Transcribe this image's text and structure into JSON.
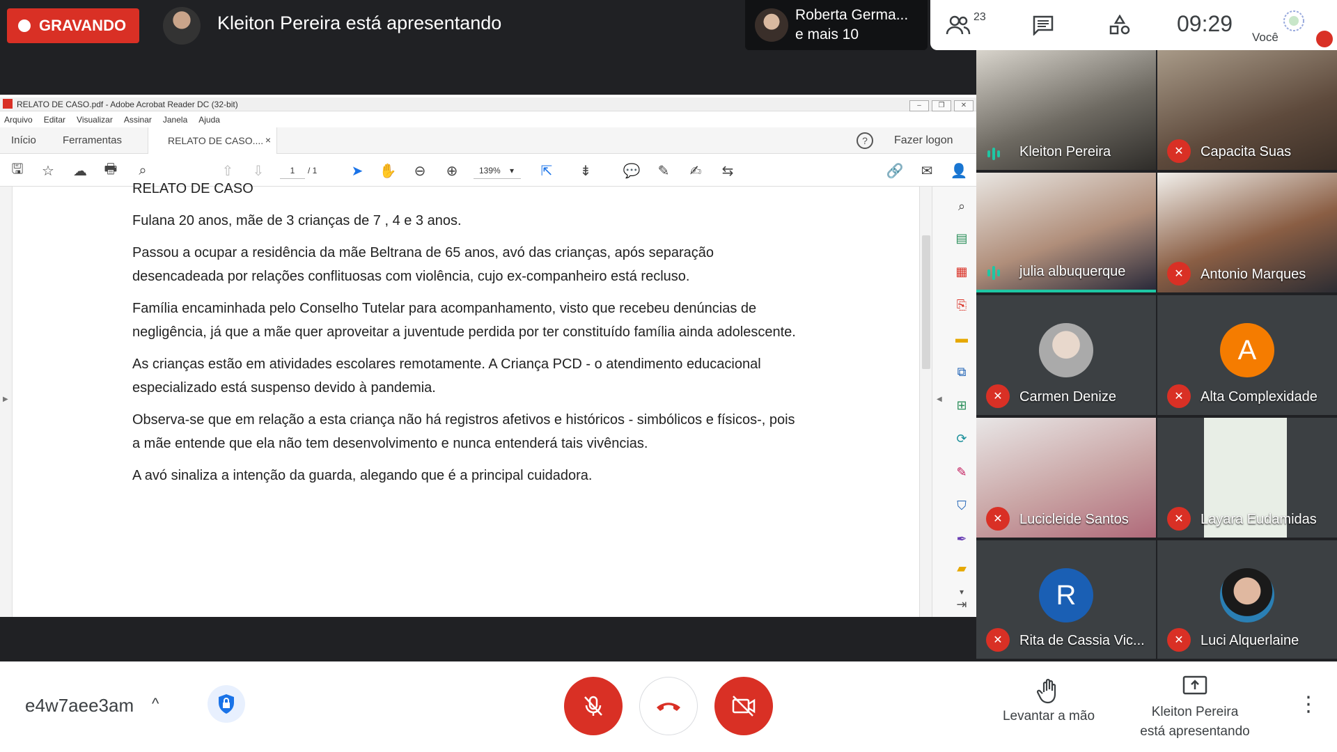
{
  "top": {
    "recording_label": "GRAVANDO",
    "presenting_title": "Kleiton Pereira está apresentando",
    "roberta_line1": "Roberta Germa...",
    "roberta_line2": "e mais 10",
    "people_count": "23",
    "clock": "09:29",
    "you_label": "Você"
  },
  "acrobat": {
    "window_title": "RELATO DE CASO.pdf - Adobe Acrobat Reader DC (32-bit)",
    "menu": [
      "Arquivo",
      "Editar",
      "Visualizar",
      "Assinar",
      "Janela",
      "Ajuda"
    ],
    "tab_home": "Início",
    "tab_tools": "Ferramentas",
    "tab_doc": "RELATO DE CASO....",
    "tab_close": "×",
    "help": "?",
    "logon": "Fazer logon",
    "page_current": "1",
    "page_total": "/ 1",
    "zoom": "139%",
    "doc_title": "RELATO DE CASO",
    "paragraphs": [
      "Fulana 20 anos, mãe de 3 crianças de 7 , 4 e 3 anos.",
      "Passou a ocupar a residência da mãe Beltrana de 65 anos, avó das crianças, após separação desencadeada por relações conflituosas com violência, cujo ex-companheiro está recluso.",
      "Família encaminhada pelo Conselho Tutelar para acompanhamento, visto que recebeu denúncias de negligência, já que a mãe quer aproveitar a juventude perdida por ter constituído família ainda adolescente.",
      "As crianças estão em atividades escolares remotamente. A Criança PCD - o atendimento educacional especializado está suspenso devido à pandemia.",
      "Observa-se que em relação a esta criança não há registros afetivos e históricos - simbólicos e físicos-, pois a mãe entende que ela não tem desenvolvimento e nunca entenderá tais vivências.",
      "A avó sinaliza a intenção da guarda, alegando que é a principal cuidadora."
    ]
  },
  "participants": [
    {
      "name": "Kleiton Pereira",
      "state": "speaking"
    },
    {
      "name": "Capacita Suas",
      "state": "muted"
    },
    {
      "name": "julia albuquerque",
      "state": "speaking"
    },
    {
      "name": "Antonio Marques",
      "state": "muted"
    },
    {
      "name": "Carmen Denize",
      "state": "muted"
    },
    {
      "name": "Alta Complexidade",
      "state": "muted",
      "initial": "A"
    },
    {
      "name": "Lucicleide Santos",
      "state": "muted"
    },
    {
      "name": "Layara Eudamidas",
      "state": "muted"
    },
    {
      "name": "Rita de Cassia Vic...",
      "state": "muted",
      "initial": "R"
    },
    {
      "name": "Luci Alquerlaine",
      "state": "muted"
    }
  ],
  "bottom": {
    "meeting_code": "e4w7aee3am",
    "caret": "^",
    "raise_hand": "Levantar a mão",
    "presenting_line1": "Kleiton Pereira",
    "presenting_line2": "está apresentando",
    "more": "⋮"
  },
  "colors": {
    "red": "#d93025",
    "dark": "#202124",
    "tile": "#3c4043",
    "speaking": "#1ec7a4",
    "blue_avatar": "#1a5fb4",
    "orange_avatar": "#f57c00"
  }
}
